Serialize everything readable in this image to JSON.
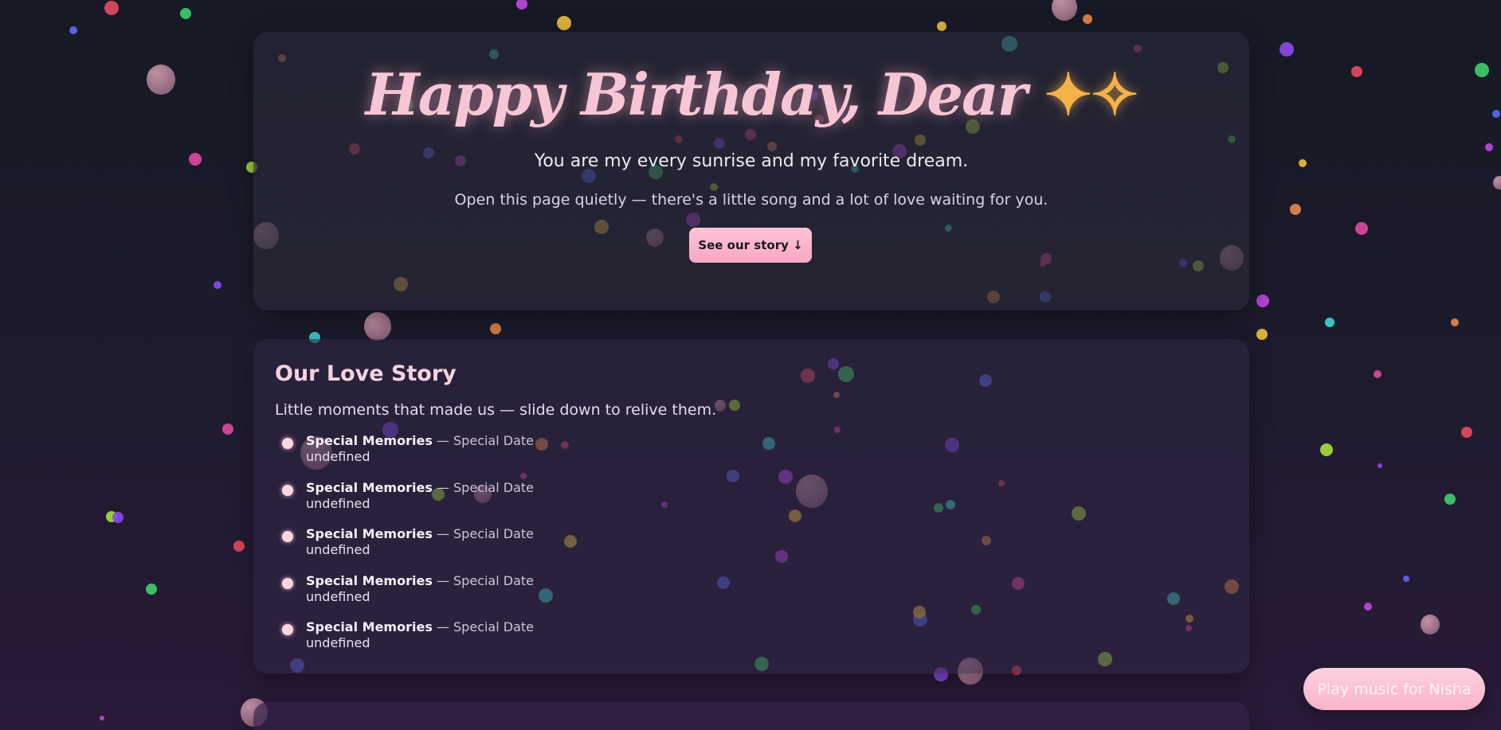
{
  "hero": {
    "title": "Happy Birthday, Dear",
    "sparkle_icon": "sparkles-icon",
    "subtitle": "You are my every sunrise and my favorite dream.",
    "note": "Open this page quietly — there's a little song and a lot of love waiting for you.",
    "story_button": "See our story ↓"
  },
  "story": {
    "title": "Our Love Story",
    "subtitle": "Little moments that made us — slide down to relive them.",
    "items": [
      {
        "title": "Special Memories",
        "separator": " — ",
        "date": "Special Date",
        "text": "undefined"
      },
      {
        "title": "Special Memories",
        "separator": " — ",
        "date": "Special Date",
        "text": "undefined"
      },
      {
        "title": "Special Memories",
        "separator": " — ",
        "date": "Special Date",
        "text": "undefined"
      },
      {
        "title": "Special Memories",
        "separator": " — ",
        "date": "Special Date",
        "text": "undefined"
      },
      {
        "title": "Special Memories",
        "separator": " — ",
        "date": "Special Date",
        "text": "undefined"
      }
    ]
  },
  "next_section": {
    "title": ""
  },
  "music_button": {
    "label": "Play music for Nisha"
  },
  "colors": {
    "accent_pink": "#f7a8c2",
    "title_pink": "#f7c6d4",
    "sparkle": "#f6b24a",
    "confetti": [
      "#e84a5f",
      "#3ecf6a",
      "#5b6cf0",
      "#c04ae0",
      "#f0c040",
      "#40d8d0",
      "#e8884a",
      "#e04aa0",
      "#a8e040",
      "#8a4ae8"
    ]
  }
}
